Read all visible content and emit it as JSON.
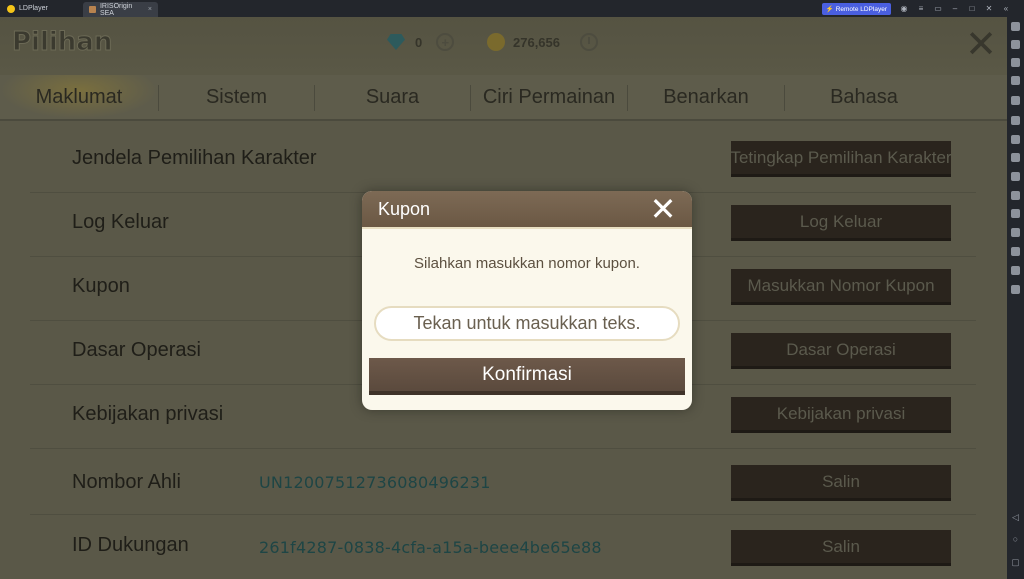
{
  "emulator": {
    "app_name": "LDPlayer",
    "tab_title": "IRISOrigin SEA",
    "tab_close": "×",
    "remote_label": "Remote LDPlayer"
  },
  "game": {
    "title": "Pilihan",
    "gems": "0",
    "coins": "276,656"
  },
  "tabs": [
    "Maklumat",
    "Sistem",
    "Suara",
    "Ciri Permainan",
    "Benarkan",
    "Bahasa"
  ],
  "rows": [
    {
      "label": "Jendela Pemilihan Karakter",
      "value": "",
      "button": "Tetingkap Pemilihan Karakter"
    },
    {
      "label": "Log Keluar",
      "value": "",
      "button": "Log Keluar"
    },
    {
      "label": "Kupon",
      "value": "",
      "button": "Masukkan Nomor Kupon"
    },
    {
      "label": "Dasar Operasi",
      "value": "",
      "button": "Dasar Operasi"
    },
    {
      "label": "Kebijakan privasi",
      "value": "",
      "button": "Kebijakan privasi"
    },
    {
      "label": "Nombor Ahli",
      "value": "UN12007512736080496231",
      "button": "Salin"
    },
    {
      "label": "ID Dukungan",
      "value": "261f4287-0838-4cfa-a15a-beee4be65e88",
      "button": "Salin"
    }
  ],
  "modal": {
    "title": "Kupon",
    "message": "Silahkan masukkan nomor kupon.",
    "input_placeholder": "Tekan untuk masukkan teks.",
    "confirm_label": "Konfirmasi"
  }
}
